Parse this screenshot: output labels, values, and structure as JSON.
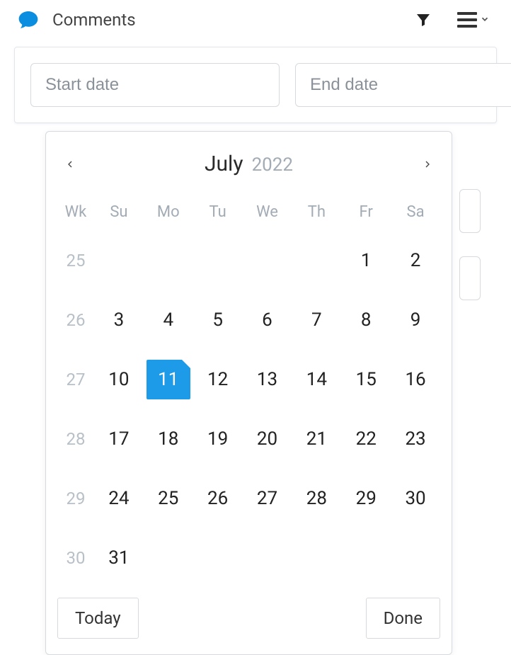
{
  "topbar": {
    "title": "Comments"
  },
  "inputs": {
    "start_placeholder": "Start date",
    "end_placeholder": "End date"
  },
  "calendar": {
    "month": "July",
    "year": "2022",
    "wk_label": "Wk",
    "dow": [
      "Su",
      "Mo",
      "Tu",
      "We",
      "Th",
      "Fr",
      "Sa"
    ],
    "today": 11,
    "weeks": [
      {
        "wk": "25",
        "days": [
          null,
          null,
          null,
          null,
          null,
          "1",
          "2"
        ]
      },
      {
        "wk": "26",
        "days": [
          "3",
          "4",
          "5",
          "6",
          "7",
          "8",
          "9"
        ]
      },
      {
        "wk": "27",
        "days": [
          "10",
          "11",
          "12",
          "13",
          "14",
          "15",
          "16"
        ]
      },
      {
        "wk": "28",
        "days": [
          "17",
          "18",
          "19",
          "20",
          "21",
          "22",
          "23"
        ]
      },
      {
        "wk": "29",
        "days": [
          "24",
          "25",
          "26",
          "27",
          "28",
          "29",
          "30"
        ]
      },
      {
        "wk": "30",
        "days": [
          "31",
          null,
          null,
          null,
          null,
          null,
          null
        ]
      }
    ],
    "today_label": "Today",
    "done_label": "Done"
  }
}
